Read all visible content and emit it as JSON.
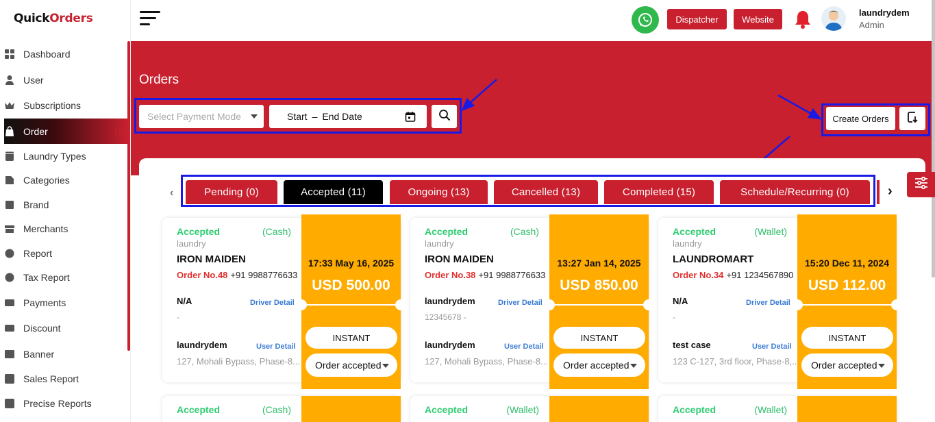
{
  "brand": {
    "logo_left": "Quick",
    "logo_o": "O",
    "logo_right": "rders"
  },
  "colors": {
    "primary": "#c8202f",
    "accent": "#ffab00",
    "status_green": "#2ecc71",
    "link_blue": "#3a7bd5",
    "annotation": "#1a1ae6"
  },
  "sidebar": {
    "items": [
      {
        "label": "Dashboard",
        "icon": "grid-icon"
      },
      {
        "label": "User",
        "icon": "user-icon"
      },
      {
        "label": "Subscriptions",
        "icon": "crown-icon"
      },
      {
        "label": "Order",
        "icon": "bag-icon",
        "count": "(0)"
      },
      {
        "label": "Laundry Types",
        "icon": "washer-icon"
      },
      {
        "label": "Categories",
        "icon": "category-icon"
      },
      {
        "label": "Brand",
        "icon": "brand-icon"
      },
      {
        "label": "Merchants",
        "icon": "store-icon"
      },
      {
        "label": "Report",
        "icon": "report-icon"
      },
      {
        "label": "Tax Report",
        "icon": "tax-icon"
      },
      {
        "label": "Payments",
        "icon": "payment-icon"
      },
      {
        "label": "Discount",
        "icon": "discount-icon"
      },
      {
        "label": "Banner",
        "icon": "image-icon"
      },
      {
        "label": "Sales Report",
        "icon": "chart-icon"
      },
      {
        "label": "Precise Reports",
        "icon": "chart-icon"
      }
    ]
  },
  "header": {
    "dispatcher": "Dispatcher",
    "website": "Website",
    "user_name": "laundrydem",
    "user_role": "Admin"
  },
  "orders": {
    "title": "Orders",
    "payment_mode_placeholder": "Select Payment Mode",
    "date_start": "Start",
    "date_sep": "–",
    "date_end": "End Date",
    "create_label": "Create Orders"
  },
  "tabs": [
    {
      "label": "Pending (0)"
    },
    {
      "label": "Accepted (11)"
    },
    {
      "label": "Ongoing (13)"
    },
    {
      "label": "Cancelled (13)"
    },
    {
      "label": "Completed (15)"
    },
    {
      "label": "Schedule/Recurring (0)"
    }
  ],
  "cards": [
    {
      "status": "Accepted",
      "payment": "(Cash)",
      "type": "laundry",
      "merchant": "IRON MAIDEN",
      "order_no": "Order No.48",
      "phone": "+91 9988776633",
      "driver": "N/A",
      "driver_link": "Driver Detail",
      "driver_phone": "-",
      "user": "laundrydem",
      "user_link": "User Detail",
      "address": "127, Mohali Bypass, Phase-8...",
      "time": "17:33 May 16, 2025",
      "amount": "USD  500.00",
      "delivery": "INSTANT",
      "order_status": "Order accepted"
    },
    {
      "status": "Accepted",
      "payment": "(Cash)",
      "type": "laundry",
      "merchant": "IRON MAIDEN",
      "order_no": "Order No.38",
      "phone": "+91 9988776633",
      "driver": "laundrydem",
      "driver_link": "Driver Detail",
      "driver_phone": "12345678 -",
      "user": "laundrydem",
      "user_link": "User Detail",
      "address": "127, Mohali Bypass, Phase-8...",
      "time": "13:27 Jan 14, 2025",
      "amount": "USD  850.00",
      "delivery": "INSTANT",
      "order_status": "Order accepted"
    },
    {
      "status": "Accepted",
      "payment": "(Wallet)",
      "type": "laundry",
      "merchant": "LAUNDROMART",
      "order_no": "Order No.34",
      "phone": "+91 1234567890",
      "driver": "N/A",
      "driver_link": "Driver Detail",
      "driver_phone": "-",
      "user": "test case",
      "user_link": "User Detail",
      "address": "123 C-127, 3rd floor, Phase-8,...",
      "time": "15:20 Dec 11, 2024",
      "amount": "USD  112.00",
      "delivery": "INSTANT",
      "order_status": "Order accepted"
    }
  ],
  "cards_row2": [
    {
      "status": "Accepted",
      "payment": "(Cash)"
    },
    {
      "status": "Accepted",
      "payment": "(Wallet)"
    },
    {
      "status": "Accepted",
      "payment": "(Wallet)"
    }
  ]
}
